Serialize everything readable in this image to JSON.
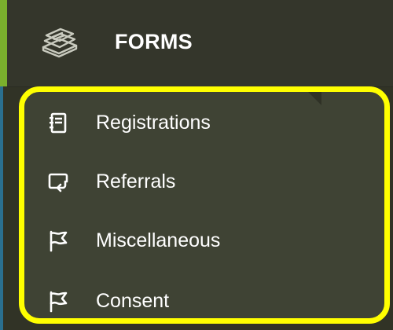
{
  "header": {
    "title": "FORMS",
    "icon": "stack-of-papers-icon"
  },
  "submenu": {
    "items": [
      {
        "label": "Registrations",
        "icon": "notebook-icon"
      },
      {
        "label": "Referrals",
        "icon": "comment-return-icon"
      },
      {
        "label": "Miscellaneous",
        "icon": "flag-icon"
      },
      {
        "label": "Consent",
        "icon": "flag-icon"
      }
    ]
  },
  "colors": {
    "background": "#313326",
    "panel": "#3f4334",
    "highlight_outline": "#ffff00",
    "accent": "#7ab02d",
    "text": "#ffffff"
  }
}
